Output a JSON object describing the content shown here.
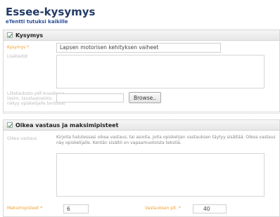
{
  "header": {
    "title": "Essee-kysymys",
    "subtitle": "eTentti tutuksi kaikille"
  },
  "question_section": {
    "title": "Kysymys",
    "name_label": "Kysymys *",
    "name_value": "Lapsen motorisen kehityksen vaiheet",
    "extra_label": "Lisätiedot",
    "file_label_line1": "Liitetiedosto pdf-muodossa",
    "file_label_line2": "(esim. taustaaineisto,",
    "file_label_line3": "näkyy opiskelijalle tentissä)",
    "browse_label": "Browse.."
  },
  "answer_section": {
    "title": "Oikea vastaus ja maksimipisteet",
    "answer_label": "Oikea vastaus",
    "help_line1": "Kirjoita halutessasi oikea vastaus, tai asioita, joita opiskelijan vastauksen täytyy sisältää. Oikea vastaus",
    "help_line2": "näy opiskelijalle. Kentän sisältö on vapaamuotoista tekstiä.",
    "points_label": "Maksimipisteet *",
    "points_value": "6",
    "length_label": "Vastauksen pit. *",
    "length_value": "40"
  }
}
